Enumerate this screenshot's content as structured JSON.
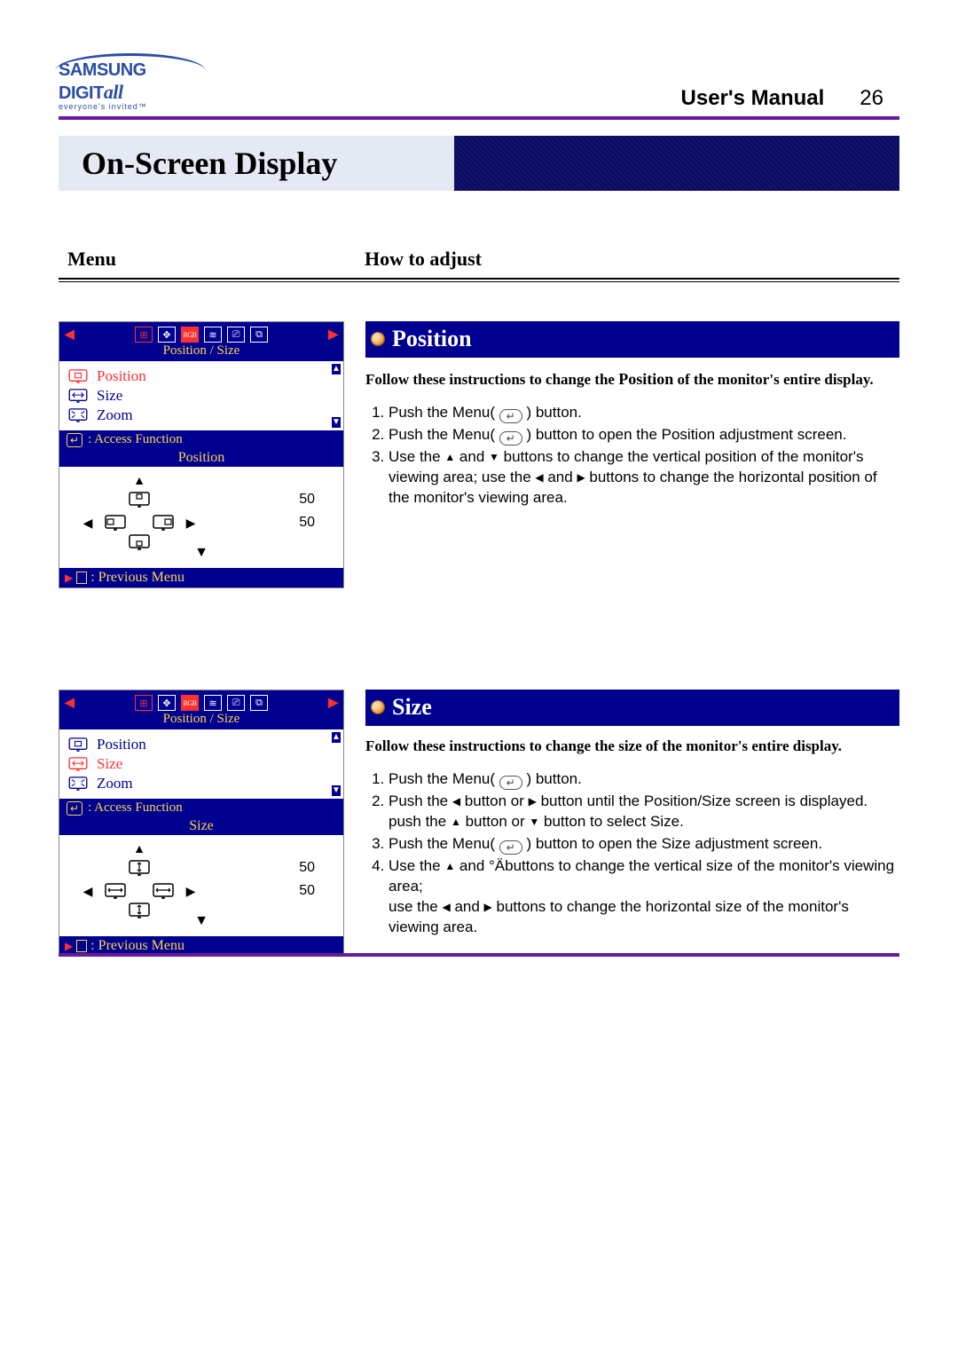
{
  "brand": {
    "name_main": "SAMSUNG DIGIT",
    "name_suffix": "all",
    "tagline": "everyone's invited™"
  },
  "header": {
    "title": "User's Manual",
    "page": "26"
  },
  "page_title": "On-Screen Display",
  "column_heads": {
    "menu": "Menu",
    "howto": "How to adjust"
  },
  "osd_common": {
    "tab_label": "Position / Size",
    "access_label": ": Access Function",
    "prev_label": ": Previous Menu",
    "items": [
      {
        "label": "Position"
      },
      {
        "label": "Size"
      },
      {
        "label": "Zoom"
      }
    ]
  },
  "sections": [
    {
      "id": "position",
      "title": "Position",
      "intro_pre": "Follow these instructions to change the ",
      "intro_kw": "Position",
      "intro_post": " of the monitor's entire display.",
      "osd": {
        "active_index": 0,
        "adjust_heading": "Position",
        "h_value": "50",
        "v_value": "50",
        "icon_mode": "position"
      },
      "steps": [
        {
          "n": "1",
          "html": "Push the Menu( {MENU} ) button."
        },
        {
          "n": "2",
          "html": "Push the Menu( {MENU} ) button to open the Position adjustment screen."
        },
        {
          "n": "3",
          "html": "Use the {UP} and {DN} buttons to change the vertical position of the monitor's viewing area; use the {LT} and {RT} buttons to change the horizontal position of the monitor's viewing area."
        }
      ]
    },
    {
      "id": "size",
      "title": "Size",
      "intro_pre": "Follow these instructions to change the size of the monitor's entire display.",
      "intro_kw": "",
      "intro_post": "",
      "osd": {
        "active_index": 1,
        "adjust_heading": "Size",
        "h_value": "50",
        "v_value": "50",
        "icon_mode": "size"
      },
      "steps": [
        {
          "n": "1",
          "html": "Push the Menu( {MENU} ) button."
        },
        {
          "n": "2",
          "html": "Push the {LT} button or {RT} button until the Position/Size screen is displayed. push the {UP} button or {DN} button to select Size."
        },
        {
          "n": "3",
          "html": "Push the Menu( {MENU} ) button to open the Size adjustment screen."
        },
        {
          "n": "4",
          "html": "Use the {UP} and °Äbuttons to change the vertical size of the monitor's viewing area;\nuse the {LT} and {RT} buttons to change the horizontal size of the monitor's viewing area."
        }
      ]
    }
  ]
}
